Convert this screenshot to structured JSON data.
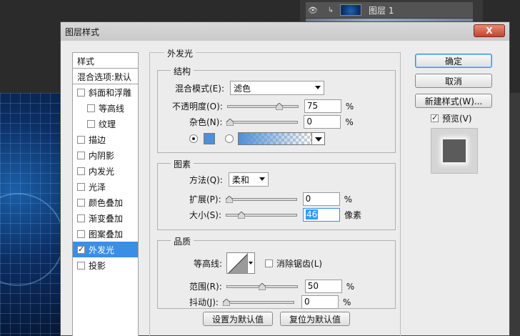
{
  "background": {
    "layer_name": "图层 1"
  },
  "dialog": {
    "title": "图层样式",
    "close_label": "X"
  },
  "style_list": {
    "header": "样式",
    "blend_options": "混合选项:默认",
    "items": [
      {
        "label": "斜面和浮雕",
        "checked": false,
        "sub": false,
        "active": false
      },
      {
        "label": "等高线",
        "checked": false,
        "sub": true,
        "active": false
      },
      {
        "label": "纹理",
        "checked": false,
        "sub": true,
        "active": false
      },
      {
        "label": "描边",
        "checked": false,
        "sub": false,
        "active": false
      },
      {
        "label": "内阴影",
        "checked": false,
        "sub": false,
        "active": false
      },
      {
        "label": "内发光",
        "checked": false,
        "sub": false,
        "active": false
      },
      {
        "label": "光泽",
        "checked": false,
        "sub": false,
        "active": false
      },
      {
        "label": "颜色叠加",
        "checked": false,
        "sub": false,
        "active": false
      },
      {
        "label": "渐变叠加",
        "checked": false,
        "sub": false,
        "active": false
      },
      {
        "label": "图案叠加",
        "checked": false,
        "sub": false,
        "active": false
      },
      {
        "label": "外发光",
        "checked": true,
        "sub": false,
        "active": true
      },
      {
        "label": "投影",
        "checked": false,
        "sub": false,
        "active": false
      }
    ]
  },
  "panel": {
    "title": "外发光",
    "structure": {
      "title": "结构",
      "blend_mode_label": "混合模式(E):",
      "blend_mode_value": "滤色",
      "opacity_label": "不透明度(O):",
      "opacity_value": "75",
      "opacity_fraction": 0.75,
      "noise_label": "杂色(N):",
      "noise_value": "0",
      "noise_fraction": 0,
      "percent": "%",
      "color_swatch": "#4f8fd9"
    },
    "elements": {
      "title": "图素",
      "method_label": "方法(Q):",
      "method_value": "柔和",
      "spread_label": "扩展(P):",
      "spread_value": "0",
      "spread_fraction": 0,
      "size_label": "大小(S):",
      "size_value": "46",
      "size_fraction": 0.184,
      "size_unit": "像素"
    },
    "quality": {
      "title": "品质",
      "contour_label": "等高线:",
      "antialias_label": "消除锯齿(L)",
      "range_label": "范围(R):",
      "range_value": "50",
      "range_fraction": 0.5,
      "jitter_label": "抖动(J):",
      "jitter_value": "0",
      "jitter_fraction": 0
    },
    "make_default": "设置为默认值",
    "reset_default": "复位为默认值"
  },
  "actions": {
    "ok": "确定",
    "cancel": "取消",
    "new_style": "新建样式(W)...",
    "preview_label": "预览(V)",
    "preview_checked": true
  },
  "colors": {
    "accent": "#3a8ee6",
    "close_red": "#c0462f"
  }
}
